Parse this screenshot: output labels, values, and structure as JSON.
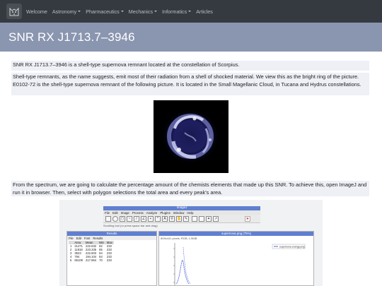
{
  "navbar": {
    "items": [
      {
        "label": "Welcome",
        "dropdown": false
      },
      {
        "label": "Astronomy",
        "dropdown": true
      },
      {
        "label": "Pharmaceutics",
        "dropdown": true
      },
      {
        "label": "Mechanics",
        "dropdown": true
      },
      {
        "label": "Informatics",
        "dropdown": true
      },
      {
        "label": "Articles",
        "dropdown": false
      }
    ],
    "background": "#343a40"
  },
  "hero": {
    "title": "SNR RX J1713.7–3946",
    "background": "#8a95b0"
  },
  "paragraphs": [
    "SNR RX J1713.7–3946 is a shell-type supernova remnant located at the constellation of Scorpius.",
    "Shell-type remnants, as the name suggests, emit most of their radiation from a shell of shocked material. We view this as the bright ring of the picture. E0102-72 is the shell-type supernova remnant of the following picture. It is located in the Small Magellanic Cloud, in Tucana and Hydrus constellations.",
    "From the spectrum, we are going to calculate the percentage amount of the chemists elements that made up this SNR. To achieve this, open ImageJ and run it in browser. Then, select with polygon selections the total area and every peak's area."
  ],
  "imagej": {
    "title": "ImageJ",
    "menu": [
      "File",
      "Edit",
      "Image",
      "Process",
      "Analyze",
      "Plugins",
      "Window",
      "Help"
    ],
    "status": "Scrolling tool (or press space bar and drag)",
    "results": {
      "title": "Results",
      "menu": [
        "File",
        "Edit",
        "Font",
        "Results"
      ],
      "columns": [
        "",
        "Area",
        "Mean",
        "Min",
        "Max"
      ],
      "rows": [
        [
          "1",
          "21471",
          "222.632",
          "82",
          "233"
        ],
        [
          "2",
          "11818",
          "223.335",
          "85",
          "233"
        ],
        [
          "3",
          "3523",
          "222.603",
          "84",
          "233"
        ],
        [
          "4",
          "794",
          "194.104",
          "84",
          "233"
        ],
        [
          "5",
          "65109",
          "217.864",
          "70",
          "233"
        ]
      ]
    },
    "plot": {
      "title": "supernova.png (75%)",
      "info": "809x441 pixels; RGB; 1.5MB",
      "legend": "supernova energy.png"
    }
  }
}
